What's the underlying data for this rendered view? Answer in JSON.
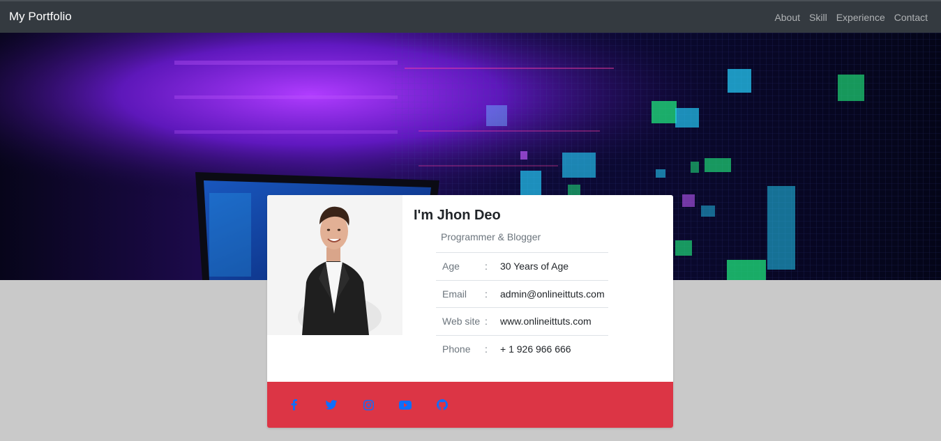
{
  "navbar": {
    "brand": "My Portfolio",
    "links": [
      "About",
      "Skill",
      "Experience",
      "Contact"
    ]
  },
  "profile": {
    "name": "I'm Jhon Deo",
    "role": "Programmer & Blogger",
    "photo_icon": "person-photo",
    "details": [
      {
        "label": "Age",
        "sep": ":",
        "value": "30 Years of Age"
      },
      {
        "label": "Email",
        "sep": ":",
        "value": "admin@onlineittuts.com"
      },
      {
        "label": "Web site",
        "sep": ":",
        "value": "www.onlineittuts.com"
      },
      {
        "label": "Phone",
        "sep": ":",
        "value": "+ 1 926 966 666"
      }
    ]
  },
  "social": {
    "background": "#dc3545",
    "icon_color": "#0d6efd",
    "icons": [
      "facebook-icon",
      "twitter-icon",
      "instagram-icon",
      "youtube-icon",
      "github-icon"
    ]
  },
  "colors": {
    "navbar_bg": "#343a40",
    "page_bg": "#c9c9c9",
    "hero_purple": "#8a2be2",
    "hero_cyan": "#27d3ff",
    "hero_green": "#21e27a"
  }
}
